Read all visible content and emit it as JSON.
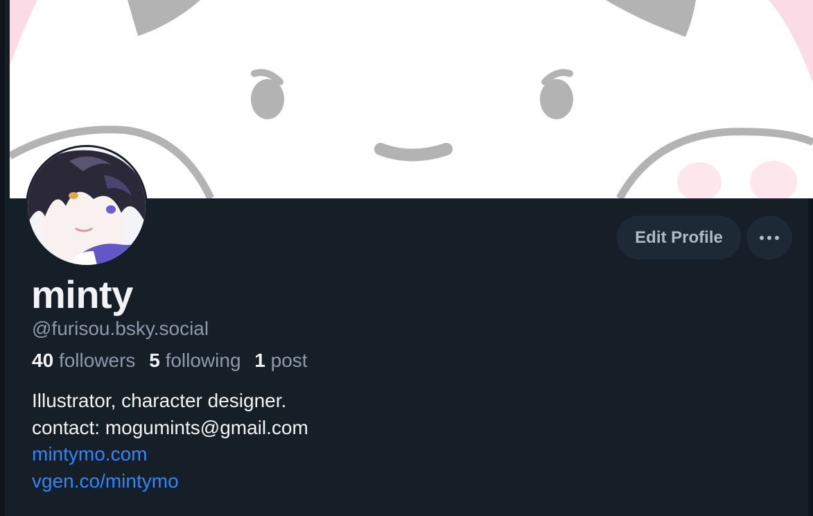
{
  "profile": {
    "display_name": "minty",
    "handle": "@furisou.bsky.social",
    "followers_count": "40",
    "followers_label": "followers",
    "following_count": "5",
    "following_label": "following",
    "posts_count": "1",
    "posts_label": "post",
    "bio_lines": [
      "Illustrator, character designer.",
      "contact: mogumints@gmail.com"
    ],
    "links": [
      "mintymo.com",
      "vgen.co/mintymo"
    ]
  },
  "actions": {
    "edit_profile_label": "Edit Profile",
    "more_icon": "ellipsis-icon"
  },
  "colors": {
    "background": "#161e27",
    "button_bg": "#1e2936",
    "link": "#2f86ff",
    "muted_text": "#8c9aab"
  }
}
